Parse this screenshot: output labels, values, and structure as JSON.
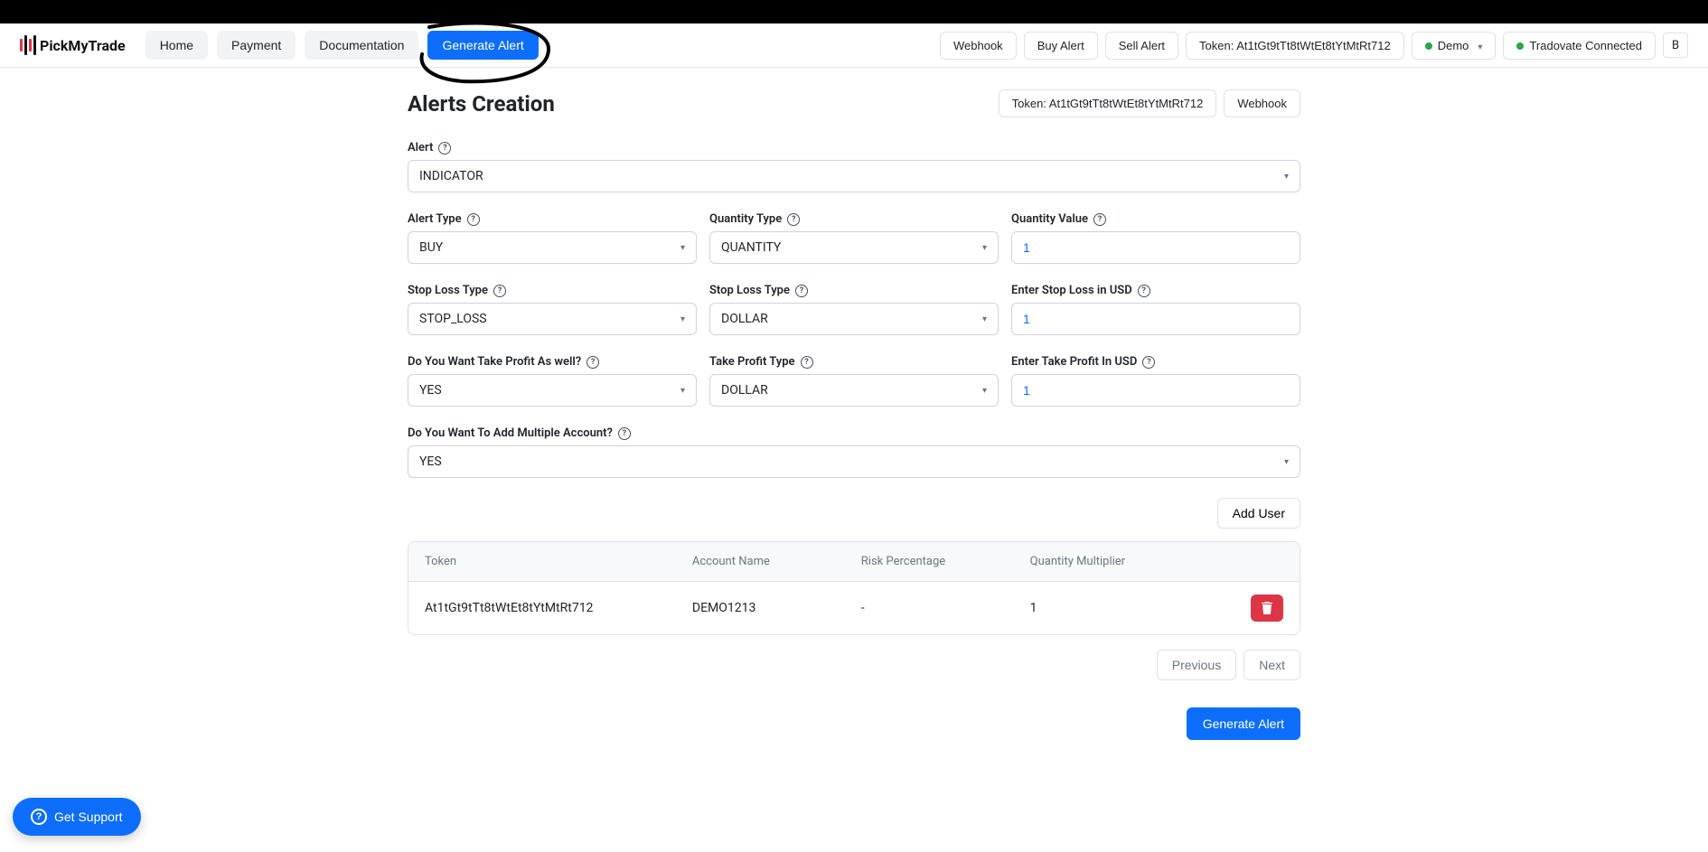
{
  "brand": "PickMyTrade",
  "nav": {
    "home": "Home",
    "payment": "Payment",
    "documentation": "Documentation",
    "generate_alert": "Generate Alert"
  },
  "topbar": {
    "webhook": "Webhook",
    "buy_alert": "Buy Alert",
    "sell_alert": "Sell Alert",
    "token_label": "Token: At1tGt9tTt8tWtEt8tYtMtRt712",
    "environment": "Demo",
    "connect_status": "Tradovate Connected",
    "user_initial": "B"
  },
  "page": {
    "title": "Alerts Creation",
    "token_chip": "Token: At1tGt9tTt8tWtEt8tYtMtRt712",
    "webhook_chip": "Webhook"
  },
  "form": {
    "alert": {
      "label": "Alert",
      "value": "INDICATOR"
    },
    "alert_type": {
      "label": "Alert Type",
      "value": "BUY"
    },
    "quantity_type": {
      "label": "Quantity Type",
      "value": "QUANTITY"
    },
    "quantity_value": {
      "label": "Quantity Value",
      "value": "1"
    },
    "stop_loss_type_a": {
      "label": "Stop Loss Type",
      "value": "STOP_LOSS"
    },
    "stop_loss_type_b": {
      "label": "Stop Loss Type",
      "value": "DOLLAR"
    },
    "stop_loss_usd": {
      "label": "Enter Stop Loss in USD",
      "value": "1"
    },
    "take_profit_want": {
      "label": "Do You Want Take Profit As well?",
      "value": "YES"
    },
    "take_profit_type": {
      "label": "Take Profit Type",
      "value": "DOLLAR"
    },
    "take_profit_usd": {
      "label": "Enter Take Profit In USD",
      "value": "1"
    },
    "multi_account": {
      "label": "Do You Want To Add Multiple Account?",
      "value": "YES"
    }
  },
  "add_user": "Add User",
  "table": {
    "headers": {
      "token": "Token",
      "account": "Account Name",
      "risk": "Risk Percentage",
      "qty": "Quantity Multiplier"
    },
    "row": {
      "token": "At1tGt9tTt8tWtEt8tYtMtRt712",
      "account": "DEMO1213",
      "risk": "-",
      "qty": "1"
    }
  },
  "pager": {
    "prev": "Previous",
    "next": "Next"
  },
  "footer_button": "Generate Alert",
  "support": "Get Support"
}
